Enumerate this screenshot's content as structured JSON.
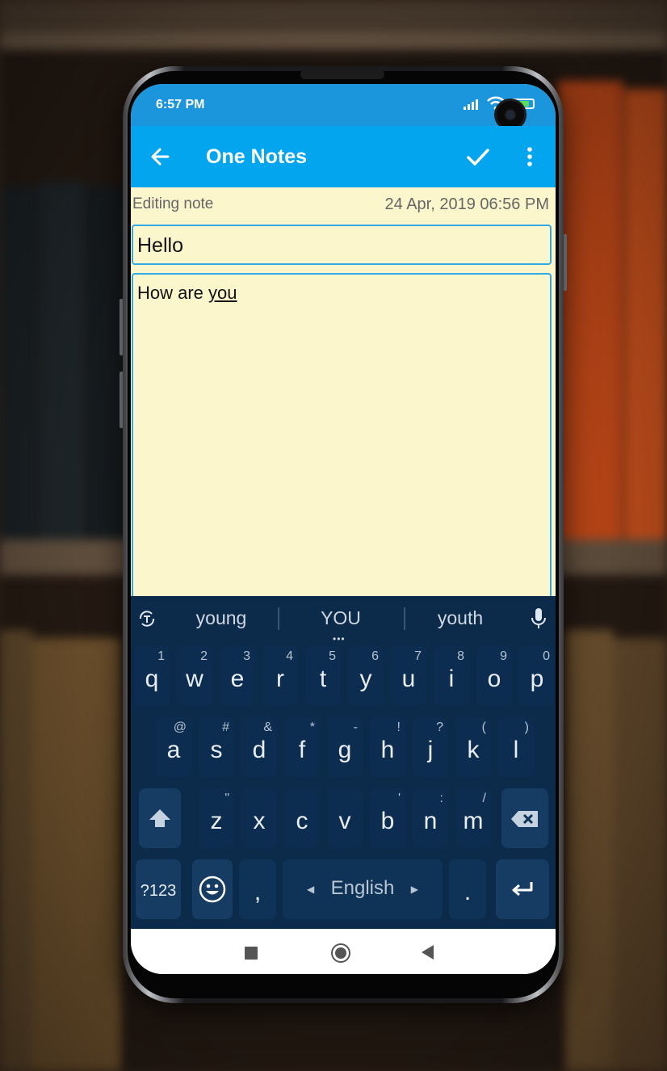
{
  "status_bar": {
    "time": "6:57 PM",
    "battery_level": "56"
  },
  "toolbar": {
    "title": "One Notes"
  },
  "note": {
    "status_label": "Editing note",
    "date": "24 Apr, 2019 06:56 PM",
    "title": "Hello",
    "body_plain": "How are ",
    "body_underlined": "you"
  },
  "keyboard": {
    "suggestions": [
      "young",
      "YOU",
      "youth"
    ],
    "suggestion_dots": "•••",
    "row1": [
      {
        "key": "q",
        "hint": "1"
      },
      {
        "key": "w",
        "hint": "2"
      },
      {
        "key": "e",
        "hint": "3"
      },
      {
        "key": "r",
        "hint": "4"
      },
      {
        "key": "t",
        "hint": "5"
      },
      {
        "key": "y",
        "hint": "6"
      },
      {
        "key": "u",
        "hint": "7"
      },
      {
        "key": "i",
        "hint": "8"
      },
      {
        "key": "o",
        "hint": "9"
      },
      {
        "key": "p",
        "hint": "0"
      }
    ],
    "row2": [
      {
        "key": "a",
        "hint": "@"
      },
      {
        "key": "s",
        "hint": "#"
      },
      {
        "key": "d",
        "hint": "&"
      },
      {
        "key": "f",
        "hint": "*"
      },
      {
        "key": "g",
        "hint": "-"
      },
      {
        "key": "h",
        "hint": "!"
      },
      {
        "key": "j",
        "hint": "?"
      },
      {
        "key": "k",
        "hint": "("
      },
      {
        "key": "l",
        "hint": ")"
      }
    ],
    "row3": [
      {
        "key": "z",
        "hint": "\""
      },
      {
        "key": "x",
        "hint": ""
      },
      {
        "key": "c",
        "hint": ""
      },
      {
        "key": "v",
        "hint": ""
      },
      {
        "key": "b",
        "hint": "'"
      },
      {
        "key": "n",
        "hint": ":"
      },
      {
        "key": "m",
        "hint": "/"
      }
    ],
    "symbols_label": "?123",
    "comma": ",",
    "space_label": "English",
    "period": ".",
    "colors": {
      "background": "#0c2b4a",
      "key": "#0f3357",
      "text": "#e9eef5"
    }
  },
  "colors": {
    "toolbar": "#03a5ee",
    "status_bar": "#1b95dc",
    "note_bg": "#fbf6cb",
    "field_border": "#31a9e6"
  },
  "icons": [
    "back-arrow-icon",
    "checkmark-icon",
    "overflow-menu-icon",
    "theme-icon",
    "microphone-icon",
    "shift-icon",
    "backspace-icon",
    "emoji-icon",
    "enter-icon"
  ]
}
